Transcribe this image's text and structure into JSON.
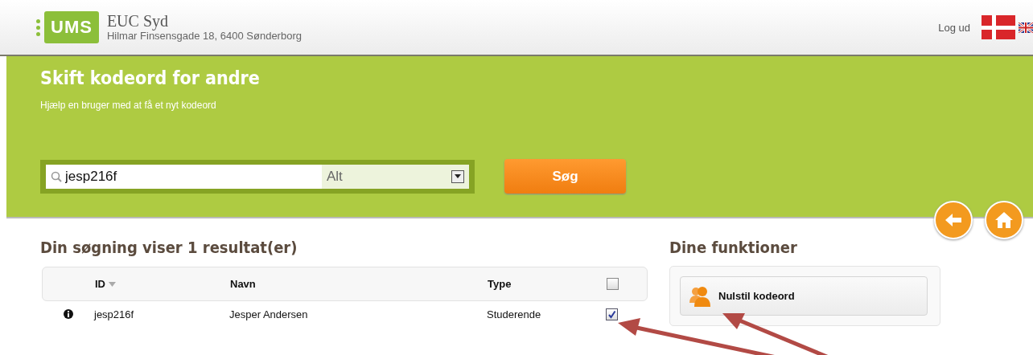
{
  "header": {
    "logo": "UMS",
    "org_name": "EUC Syd",
    "address": "Hilmar Finsensgade 18, 6400 Sønderborg",
    "logout": "Log ud"
  },
  "banner": {
    "title": "Skift kodeord for andre",
    "subtitle": "Hjælp en bruger med at få et nyt kodeord",
    "search": {
      "value": "jesp216f"
    },
    "filter": {
      "value": "Alt"
    },
    "search_button": "Søg"
  },
  "results": {
    "heading": "Din søgning viser 1 resultat(er)",
    "columns": [
      "ID",
      "Navn",
      "Type"
    ],
    "select_all": {
      "checked": false
    },
    "rows": [
      {
        "id": "jesp216f",
        "name": "Jesper Andersen",
        "type": "Studerende",
        "checked": true
      }
    ]
  },
  "functions": {
    "heading": "Dine funktioner",
    "items": [
      "Nulstil kodeord"
    ]
  }
}
